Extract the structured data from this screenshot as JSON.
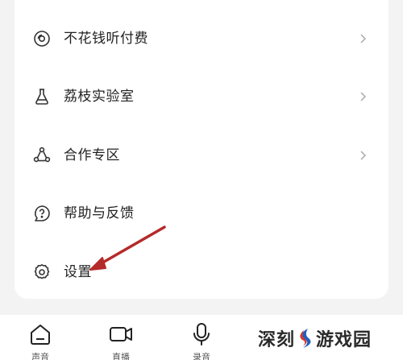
{
  "menu": {
    "items": [
      {
        "label": "不花钱听付费",
        "icon": "disc-icon",
        "has_chevron": true
      },
      {
        "label": "荔枝实验室",
        "icon": "flask-icon",
        "has_chevron": true
      },
      {
        "label": "合作专区",
        "icon": "share-icon",
        "has_chevron": true
      },
      {
        "label": "帮助与反馈",
        "icon": "help-chat-icon",
        "has_chevron": false
      },
      {
        "label": "设置",
        "icon": "gear-icon",
        "has_chevron": false
      }
    ]
  },
  "bottom_nav": {
    "tabs": [
      {
        "label": "声音",
        "icon": "home-icon"
      },
      {
        "label": "直播",
        "icon": "video-camera-icon"
      },
      {
        "label": "录音",
        "icon": "microphone-icon"
      }
    ]
  },
  "watermark": {
    "left_text": "深刻",
    "right_text": "游戏园"
  },
  "colors": {
    "background": "#f3f3f3",
    "card": "#ffffff",
    "annotation_arrow": "#b52a2a",
    "watermark_blue": "#1f5fbf",
    "watermark_red": "#d23a2f"
  }
}
